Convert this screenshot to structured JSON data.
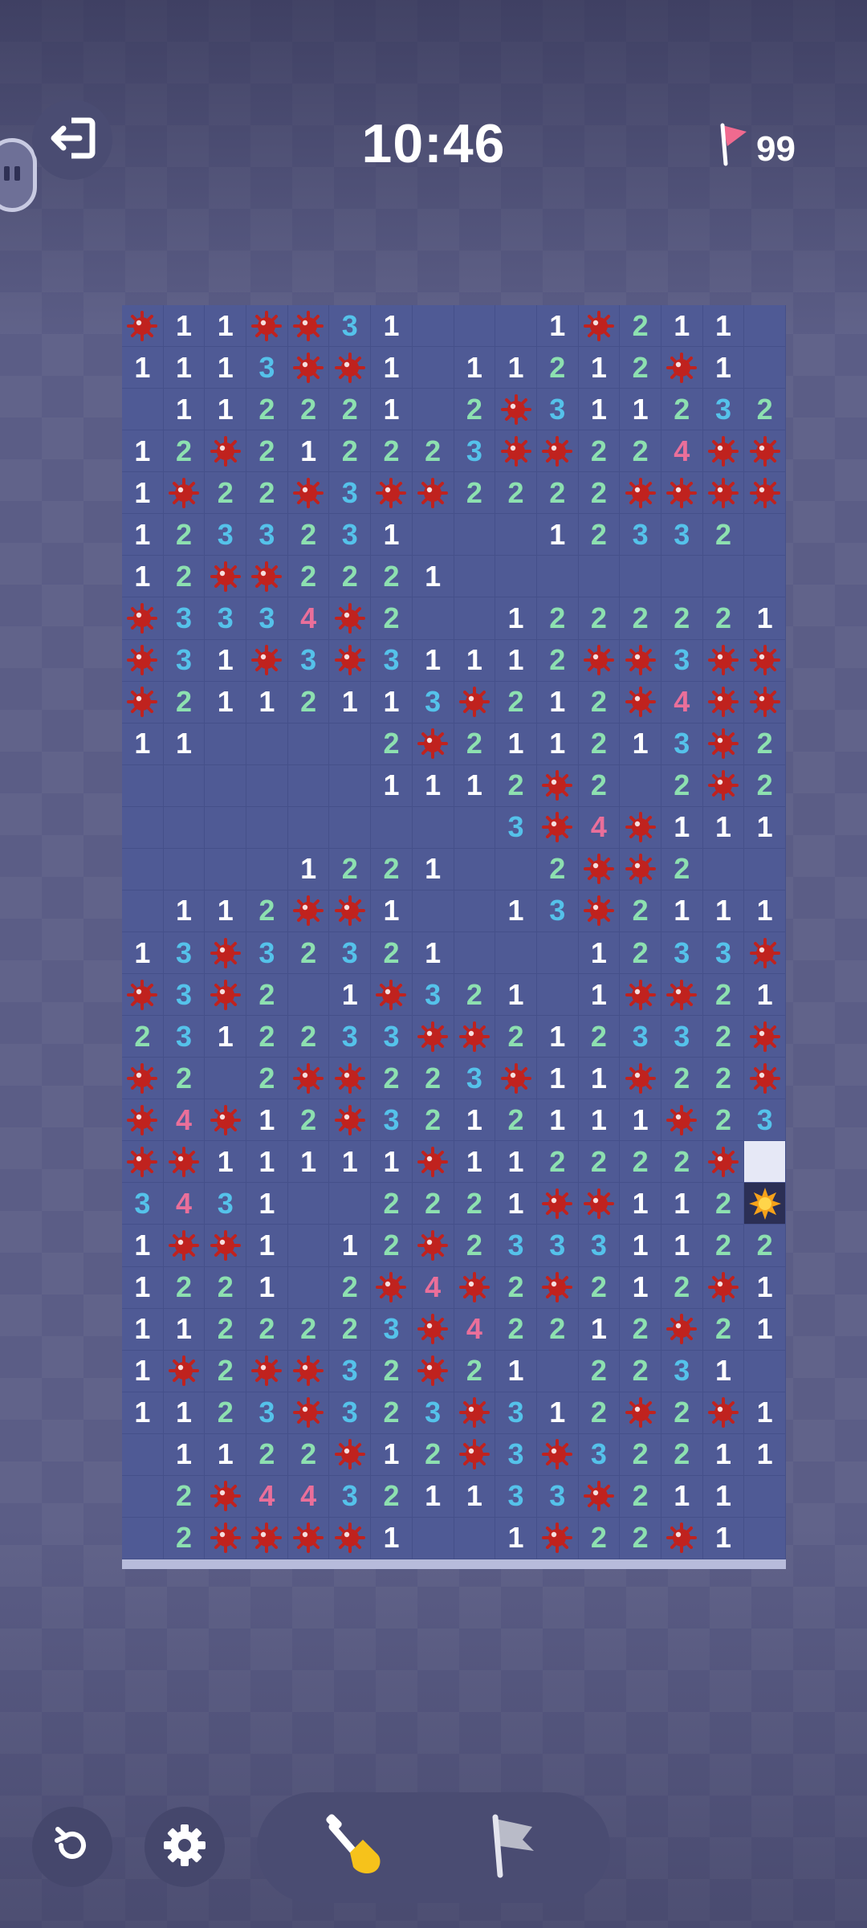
{
  "header": {
    "timer": "10:46",
    "flags_remaining": "99"
  },
  "icons": {
    "exit": "exit-icon",
    "side": "pause-icon",
    "flag": "flag-icon",
    "restart": "restart-icon",
    "settings": "gear-icon",
    "dig": "shovel-icon",
    "flag_mode": "flag-mode-icon",
    "mine": "mine-icon",
    "exploded": "exploded-mine-icon"
  },
  "colors": {
    "one": "#ffffff",
    "two": "#8de0b0",
    "three": "#55c2ea",
    "four": "#ea6f9a",
    "mine": "#c0221e",
    "board": "#4f5a95"
  },
  "board": {
    "columns": 16,
    "rows": [
      "M11MM31...1M211.",
      "1113MM1.11212M1.",
      ".112221.2M311232",
      "12M212223MM224MM",
      "1M22M3MM2222MMMM",
      "1233231...12332",
      "12MM2221........",
      "M3334M2..1222221",
      "M31M3M31112MM3MM1",
      "M2112113M212M4MM2",
      "11....2M211213M2",
      "......1112M2.2M2",
      ".........3M4M1111",
      "....1221..2MM2...",
      ".112MM1..13M2111",
      "13M32321...1233M1",
      "M3M2.1M321.1MM21",
      "2312233MM212332M1",
      "M2.2MM223M11M22M",
      "M4M12M3212111M232",
      "MM11111M112222MH",
      "3431..2221MM112X",
      "1MM1.12M233311222",
      "1221.2M4M2M212M1",
      "1122223M42212M211",
      "1M2MM32M21.2231 1",
      "1123M323M312M2M1",
      ".1122M12M3M32211",
      ".2M44321133M211.",
      ".2MMMM1..1M22M1."
    ]
  }
}
